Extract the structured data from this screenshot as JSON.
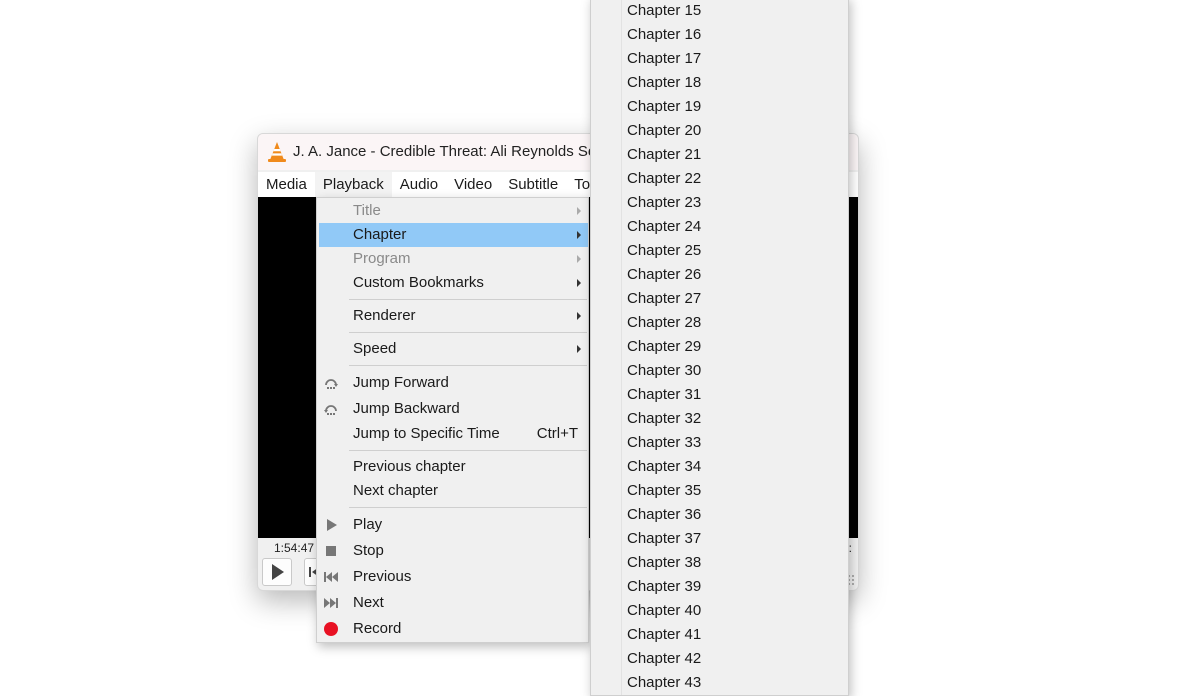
{
  "window": {
    "title": "J. A. Jance - Credible Threat: Ali Reynolds Seri",
    "menubar": [
      "Media",
      "Playback",
      "Audio",
      "Video",
      "Subtitle",
      "To"
    ],
    "time_current": "1:54:47",
    "time_total": ":"
  },
  "playback_menu": {
    "items": [
      {
        "label": "Title",
        "disabled": true,
        "submenu": true,
        "icon": ""
      },
      {
        "label": "Chapter",
        "highlighted": true,
        "submenu": true,
        "icon": ""
      },
      {
        "label": "Program",
        "disabled": true,
        "submenu": true,
        "icon": ""
      },
      {
        "label": "Custom Bookmarks",
        "submenu": true,
        "icon": ""
      },
      {
        "label": "Renderer",
        "submenu": true,
        "icon": ""
      },
      {
        "label": "Speed",
        "submenu": true,
        "icon": ""
      },
      {
        "label": "Jump Forward",
        "icon": "jump-forward-icon"
      },
      {
        "label": "Jump Backward",
        "icon": "jump-backward-icon"
      },
      {
        "label": "Jump to Specific Time",
        "shortcut": "Ctrl+T",
        "icon": ""
      },
      {
        "label": "Previous chapter",
        "icon": ""
      },
      {
        "label": "Next chapter",
        "icon": ""
      },
      {
        "label": "Play",
        "icon": "play-icon"
      },
      {
        "label": "Stop",
        "icon": "stop-icon"
      },
      {
        "label": "Previous",
        "icon": "previous-icon"
      },
      {
        "label": "Next",
        "icon": "next-icon"
      },
      {
        "label": "Record",
        "icon": "record-icon"
      }
    ]
  },
  "chapter_menu": {
    "items": [
      "Chapter 15",
      "Chapter 16",
      "Chapter 17",
      "Chapter 18",
      "Chapter 19",
      "Chapter 20",
      "Chapter 21",
      "Chapter 22",
      "Chapter 23",
      "Chapter 24",
      "Chapter 25",
      "Chapter 26",
      "Chapter 27",
      "Chapter 28",
      "Chapter 29",
      "Chapter 30",
      "Chapter 31",
      "Chapter 32",
      "Chapter 33",
      "Chapter 34",
      "Chapter 35",
      "Chapter 36",
      "Chapter 37",
      "Chapter 38",
      "Chapter 39",
      "Chapter 40",
      "Chapter 41",
      "Chapter 42",
      "Chapter 43"
    ]
  },
  "colors": {
    "highlight": "#91c9f7",
    "menu_bg": "#f0f0f0",
    "vlc_orange": "#f08a1c",
    "record_red": "#e81123"
  }
}
